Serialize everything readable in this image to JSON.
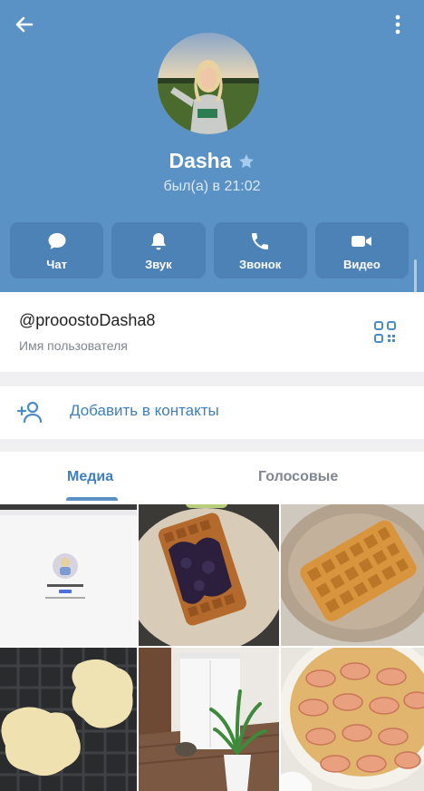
{
  "profile": {
    "name": "Dasha",
    "status": "был(а) в 21:02",
    "username": "@prooostoDasha8",
    "username_caption": "Имя пользователя"
  },
  "actions": [
    {
      "label": "Чат",
      "icon": "chat-bubble-icon"
    },
    {
      "label": "Звук",
      "icon": "bell-icon"
    },
    {
      "label": "Звонок",
      "icon": "phone-icon"
    },
    {
      "label": "Видео",
      "icon": "video-camera-icon"
    }
  ],
  "add_contact": {
    "label": "Добавить в контакты",
    "icon": "add-person-icon"
  },
  "tabs": [
    {
      "label": "Медиа",
      "active": true
    },
    {
      "label": "Голосовые",
      "active": false
    }
  ],
  "media": [
    {
      "name": "screenshot"
    },
    {
      "name": "waffles-blueberry"
    },
    {
      "name": "waffle-plate"
    },
    {
      "name": "waffle-iron-batter"
    },
    {
      "name": "room-plant"
    },
    {
      "name": "peach-tart"
    }
  ],
  "colors": {
    "header": "#5a92c5",
    "action_button": "#4c82b5",
    "accent": "#3d7fbf"
  }
}
